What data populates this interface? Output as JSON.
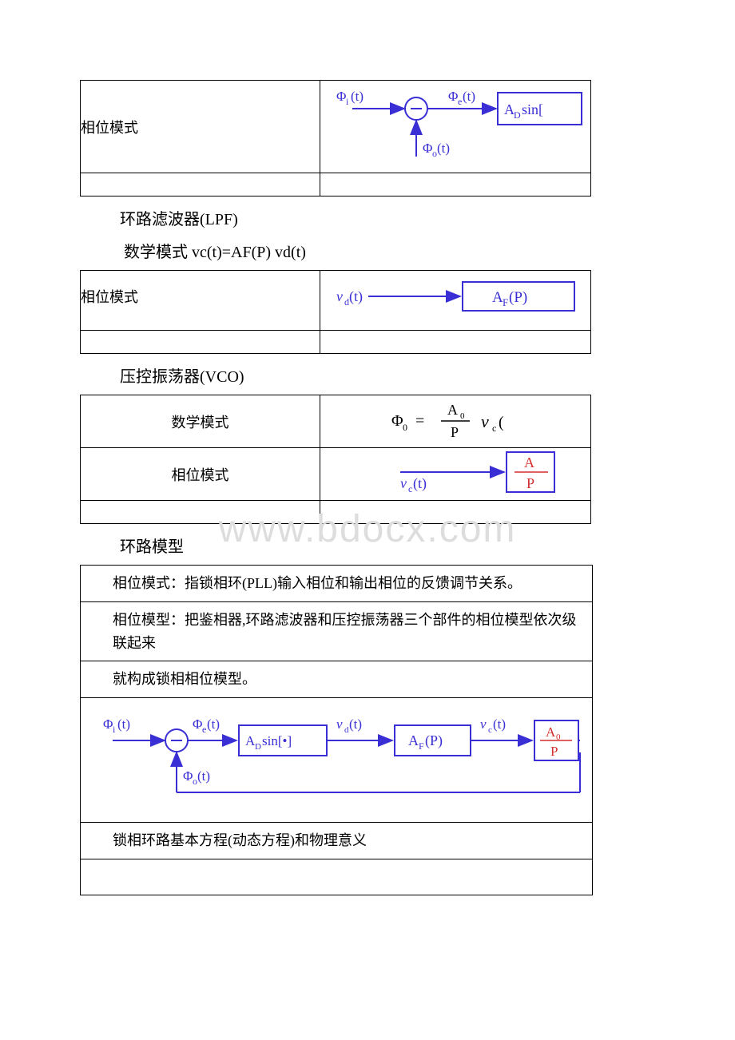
{
  "watermark": "www.bdocx.com",
  "t1": {
    "r1c1": "相位模式",
    "diag": {
      "phi_i": "Φᵢ(t)",
      "phi_o": "Φₒ(t)",
      "phi_e": "Φₑ(t)",
      "box": "A_D sin["
    }
  },
  "lpf_heading": "环路滤波器(LPF)",
  "lpf_math": "数学模式 vc(t)=AF(P) vd(t)",
  "t2": {
    "r1c1": "相位模式",
    "diag": {
      "vd": "v_d(t)",
      "box": "A_F(P)"
    }
  },
  "vco_heading": "压控振荡器(VCO)",
  "t3": {
    "r1c1": "数学模式",
    "r1_eq": {
      "phi0": "Φ₀",
      "eq": " = ",
      "frac_top": "A₀",
      "frac_bot": "P",
      "vc": "v_c("
    },
    "r2c1": "相位模式",
    "r2_diag": {
      "vc": "v_c(t)",
      "frac_top": "A",
      "frac_bot": "P"
    }
  },
  "loop_heading": "环路模型",
  "info": {
    "row1": "相位模式：指锁相环(PLL)输入相位和输出相位的反馈调节关系。",
    "row2a": "相位模型：把鉴相器,环路滤波器和压控振荡器三个部件的相位模型依次级联起来",
    "row3": "就构成锁相相位模型。",
    "row5": "锁相环路基本方程(动态方程)和物理意义"
  },
  "big_diag": {
    "phi_i": "Φᵢ(t)",
    "phi_o": "Φₒ(t)",
    "phi_e": "Φₑ(t)",
    "box1": "A_D sin[•]",
    "vd": "v_d(t)",
    "box2": "A_F(P)",
    "vc": "v_c(t)",
    "frac_top": "A₀",
    "frac_bot": "P"
  }
}
